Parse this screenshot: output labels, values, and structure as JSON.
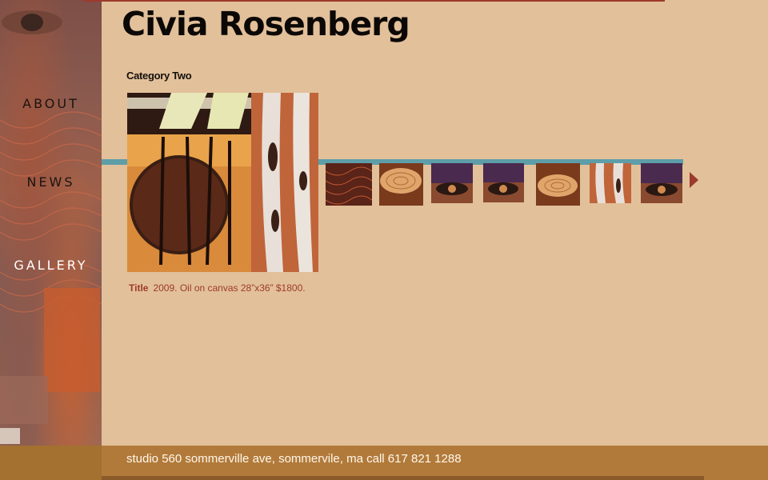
{
  "site": {
    "title": "Civia Rosenberg"
  },
  "nav": {
    "items": [
      {
        "label": "ABOUT"
      },
      {
        "label": "NEWS"
      },
      {
        "label": "GALLERY"
      }
    ]
  },
  "gallery": {
    "category": "Category Two",
    "caption": {
      "title": "Title",
      "details": "2009. Oil on canvas 28”x36” $1800."
    },
    "thumbnails": [
      {
        "name": "red-texture"
      },
      {
        "name": "wood-slice"
      },
      {
        "name": "eye-purple"
      },
      {
        "name": "eye-purple"
      },
      {
        "name": "wood-slice"
      },
      {
        "name": "birch-trees"
      },
      {
        "name": "eye-purple"
      }
    ]
  },
  "footer": {
    "text": "studio 560 sommerville ave, sommervile, ma  call 617 821 1288"
  },
  "colors": {
    "accent": "#9c3a2c",
    "teal": "#5d9ea9",
    "background": "#e2c09a",
    "footer": "#b27a3a"
  }
}
